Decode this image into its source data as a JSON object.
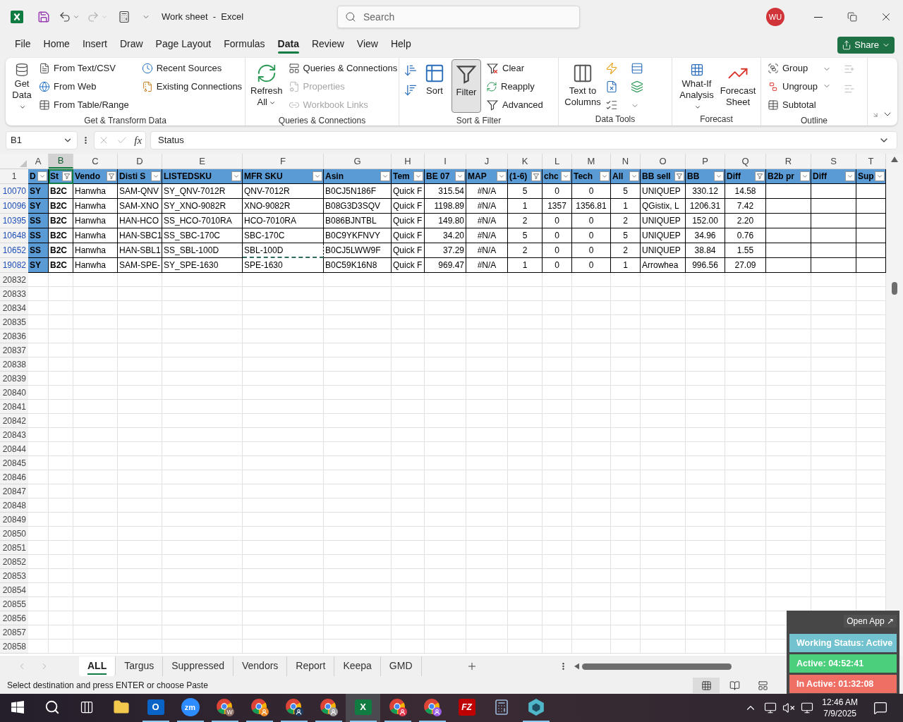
{
  "title_bar": {
    "title": "Work sheet  -  Excel",
    "search_placeholder": "Search",
    "avatar": "WU"
  },
  "menu_tabs": [
    {
      "label": "File",
      "selected": false
    },
    {
      "label": "Home",
      "selected": false
    },
    {
      "label": "Insert",
      "selected": false
    },
    {
      "label": "Draw",
      "selected": false
    },
    {
      "label": "Page Layout",
      "selected": false
    },
    {
      "label": "Formulas",
      "selected": false
    },
    {
      "label": "Data",
      "selected": true
    },
    {
      "label": "Review",
      "selected": false
    },
    {
      "label": "View",
      "selected": false
    },
    {
      "label": "Help",
      "selected": false
    }
  ],
  "share_button": "Share",
  "ribbon": [
    {
      "label": "Get & Transform Data",
      "items": [
        {
          "label": "Get Data"
        },
        {
          "label": "From Text/CSV"
        },
        {
          "label": "From Web"
        },
        {
          "label": "From Table/Range"
        },
        {
          "label": "Recent Sources"
        },
        {
          "label": "Existing Connections"
        }
      ]
    },
    {
      "label": "Queries & Connections",
      "items": [
        {
          "label": "Refresh All",
          "disabled": false
        },
        {
          "label": "Queries & Connections",
          "disabled": false
        },
        {
          "label": "Properties",
          "disabled": true
        },
        {
          "label": "Workbook Links",
          "disabled": true
        }
      ]
    },
    {
      "label": "Sort & Filter",
      "items": [
        {
          "label": "Sort",
          "selected": false
        },
        {
          "label": "Filter",
          "selected": true
        },
        {
          "label": "Clear",
          "selected": false
        },
        {
          "label": "Reapply",
          "selected": false
        },
        {
          "label": "Advanced",
          "selected": false
        }
      ]
    },
    {
      "label": "Data Tools",
      "items": [
        {
          "label": "Text to Columns"
        }
      ]
    },
    {
      "label": "Forecast",
      "items": [
        {
          "label": "What-If Analysis"
        },
        {
          "label": "Forecast Sheet"
        }
      ]
    },
    {
      "label": "Outline",
      "items": [
        {
          "label": "Group"
        },
        {
          "label": "Ungroup"
        },
        {
          "label": "Subtotal"
        }
      ]
    }
  ],
  "formula_bar": {
    "name_box": "B1",
    "function_label": "fx",
    "value": "Status"
  },
  "sheet": {
    "header_row_number": "1",
    "columns": [
      {
        "letter": "A",
        "selected": false,
        "header": "D",
        "filtered": false
      },
      {
        "letter": "B",
        "selected": true,
        "header": "St",
        "filtered": true
      },
      {
        "letter": "C",
        "selected": false,
        "header": "Vendo",
        "filtered": true
      },
      {
        "letter": "D",
        "selected": false,
        "header": "Disti S",
        "filtered": false
      },
      {
        "letter": "E",
        "selected": false,
        "header": "LISTEDSKU",
        "filtered": false
      },
      {
        "letter": "F",
        "selected": false,
        "header": "MFR SKU",
        "filtered": false
      },
      {
        "letter": "G",
        "selected": false,
        "header": "Asin",
        "filtered": false
      },
      {
        "letter": "H",
        "selected": false,
        "header": "Tem",
        "filtered": false
      },
      {
        "letter": "I",
        "selected": false,
        "header": "BE 07",
        "filtered": false
      },
      {
        "letter": "J",
        "selected": false,
        "header": "MAP",
        "filtered": false
      },
      {
        "letter": "K",
        "selected": false,
        "header": "(1-6)",
        "filtered": true
      },
      {
        "letter": "L",
        "selected": false,
        "header": "chc",
        "filtered": false
      },
      {
        "letter": "M",
        "selected": false,
        "header": "Tech",
        "filtered": false
      },
      {
        "letter": "N",
        "selected": false,
        "header": "All",
        "filtered": false
      },
      {
        "letter": "O",
        "selected": false,
        "header": "BB sell",
        "filtered": true
      },
      {
        "letter": "P",
        "selected": false,
        "header": "BB",
        "filtered": false
      },
      {
        "letter": "Q",
        "selected": false,
        "header": "Diff",
        "filtered": true
      },
      {
        "letter": "R",
        "selected": false,
        "header": "B2b pr",
        "filtered": false
      },
      {
        "letter": "S",
        "selected": false,
        "header": "Diff",
        "filtered": false
      },
      {
        "letter": "T",
        "selected": false,
        "header": "Sup",
        "filtered": false
      }
    ],
    "rows": [
      {
        "number": "10070",
        "filtered": true,
        "cells": [
          "SY",
          "B2C",
          "Hanwha",
          "SAM-QNV",
          "SY_QNV-7012R",
          {
            "text": "QNV-7012R",
            "copied": false
          },
          "B0CJ5N186F",
          "Quick F",
          "315.54",
          "#N/A",
          "5",
          "0",
          "0",
          "5",
          "UNIQUEP",
          "330.12",
          "14.58"
        ]
      },
      {
        "number": "10096",
        "filtered": true,
        "cells": [
          "SY",
          "B2C",
          "Hanwha",
          "SAM-XNO",
          "SY_XNO-9082R",
          {
            "text": "XNO-9082R",
            "copied": false
          },
          "B08G3D3SQV",
          "Quick F",
          "1198.89",
          "#N/A",
          "1",
          "1357",
          "1356.81",
          "1",
          "QGistix, L",
          "1206.31",
          "7.42"
        ]
      },
      {
        "number": "10395",
        "filtered": true,
        "cells": [
          "SS",
          "B2C",
          "Hanwha",
          "HAN-HCO",
          "SS_HCO-7010RA",
          {
            "text": "HCO-7010RA",
            "copied": false
          },
          "B086BJNTBL",
          "Quick F",
          "149.80",
          "#N/A",
          "2",
          "0",
          "0",
          "2",
          "UNIQUEP",
          "152.00",
          "2.20"
        ]
      },
      {
        "number": "10648",
        "filtered": true,
        "cells": [
          "SS",
          "B2C",
          "Hanwha",
          "HAN-SBC1",
          "SS_SBC-170C",
          {
            "text": "SBC-170C",
            "copied": false
          },
          "B0C9YKFNVY",
          "Quick F",
          "34.20",
          "#N/A",
          "5",
          "0",
          "0",
          "5",
          "UNIQUEP",
          "34.96",
          "0.76"
        ]
      },
      {
        "number": "10652",
        "filtered": true,
        "cells": [
          "SS",
          "B2C",
          "Hanwha",
          "HAN-SBL1",
          "SS_SBL-100D",
          {
            "text": "SBL-100D",
            "copied": true
          },
          "B0CJ5LWW9F",
          "Quick F",
          "37.29",
          "#N/A",
          "2",
          "0",
          "0",
          "2",
          "UNIQUEP",
          "38.84",
          "1.55"
        ]
      },
      {
        "number": "19082",
        "filtered": true,
        "cells": [
          "SY",
          "B2C",
          "Hanwha",
          "SAM-SPE-",
          "SY_SPE-1630",
          {
            "text": "SPE-1630",
            "copied": false
          },
          "B0C59K16N8",
          "Quick F",
          "969.47",
          "#N/A",
          "1",
          "0",
          "0",
          "1",
          "Arrowhea",
          "996.56",
          "27.09"
        ]
      }
    ],
    "empty_rows": [
      "20832",
      "20833",
      "20834",
      "20835",
      "20836",
      "20837",
      "20838",
      "20839",
      "20840",
      "20841",
      "20842",
      "20843",
      "20844",
      "20845",
      "20846",
      "20847",
      "20848",
      "20849",
      "20850",
      "20851",
      "20852",
      "20853",
      "20854",
      "20855",
      "20856",
      "20857",
      "20858"
    ]
  },
  "sheet_tabs": [
    {
      "label": "ALL",
      "selected": true
    },
    {
      "label": "Targus",
      "selected": false
    },
    {
      "label": "Suppressed",
      "selected": false
    },
    {
      "label": "Vendors",
      "selected": false
    },
    {
      "label": "Report",
      "selected": false
    },
    {
      "label": "Keepa",
      "selected": false
    },
    {
      "label": "GMD",
      "selected": false
    }
  ],
  "status_bar": {
    "message": "Select destination and press ENTER or choose Paste",
    "views": [
      {
        "kind": "normal",
        "selected": true
      },
      {
        "kind": "page-layout",
        "selected": false
      },
      {
        "kind": "page-break",
        "selected": false
      }
    ]
  },
  "tracker": {
    "open_app": "Open App ↗",
    "statuses": [
      {
        "text": "Working Status: Active",
        "color": "#72c2cf"
      },
      {
        "text": "Active: 04:52:41",
        "color": "#4ccf7c"
      },
      {
        "text": "In Active: 01:32:08",
        "color": "#ef6f64"
      }
    ]
  },
  "taskbar": {
    "apps": [
      {
        "kind": "start",
        "running": false,
        "selected": false
      },
      {
        "kind": "search",
        "running": false,
        "selected": false
      },
      {
        "kind": "task-view",
        "running": false,
        "selected": false
      },
      {
        "kind": "folder",
        "running": false,
        "selected": false
      },
      {
        "kind": "mail",
        "glyph": "O",
        "running": true,
        "selected": false
      },
      {
        "kind": "video",
        "glyph": "zm",
        "running": true,
        "selected": false
      },
      {
        "kind": "browser",
        "color": "#8d6e63",
        "glyph": "W",
        "running": true,
        "selected": false
      },
      {
        "kind": "browser",
        "color": "#f08a24",
        "running": true,
        "selected": false
      },
      {
        "kind": "browser",
        "color": "#1f3a5f",
        "running": true,
        "selected": false
      },
      {
        "kind": "browser",
        "color": "#9e9e9e",
        "running": true,
        "selected": false
      },
      {
        "kind": "sheet",
        "glyph": "X",
        "running": true,
        "selected": true
      },
      {
        "kind": "browser",
        "color": "#e53950",
        "running": true,
        "selected": false
      },
      {
        "kind": "browser",
        "color": "#9b5de5",
        "running": true,
        "selected": false
      },
      {
        "kind": "ftp",
        "glyph": "FZ",
        "running": false,
        "selected": false
      },
      {
        "kind": "calculator",
        "running": false,
        "selected": false
      },
      {
        "kind": "hexagon",
        "running": true,
        "selected": false
      }
    ],
    "time": "12:46 AM",
    "date": "7/9/2025"
  }
}
